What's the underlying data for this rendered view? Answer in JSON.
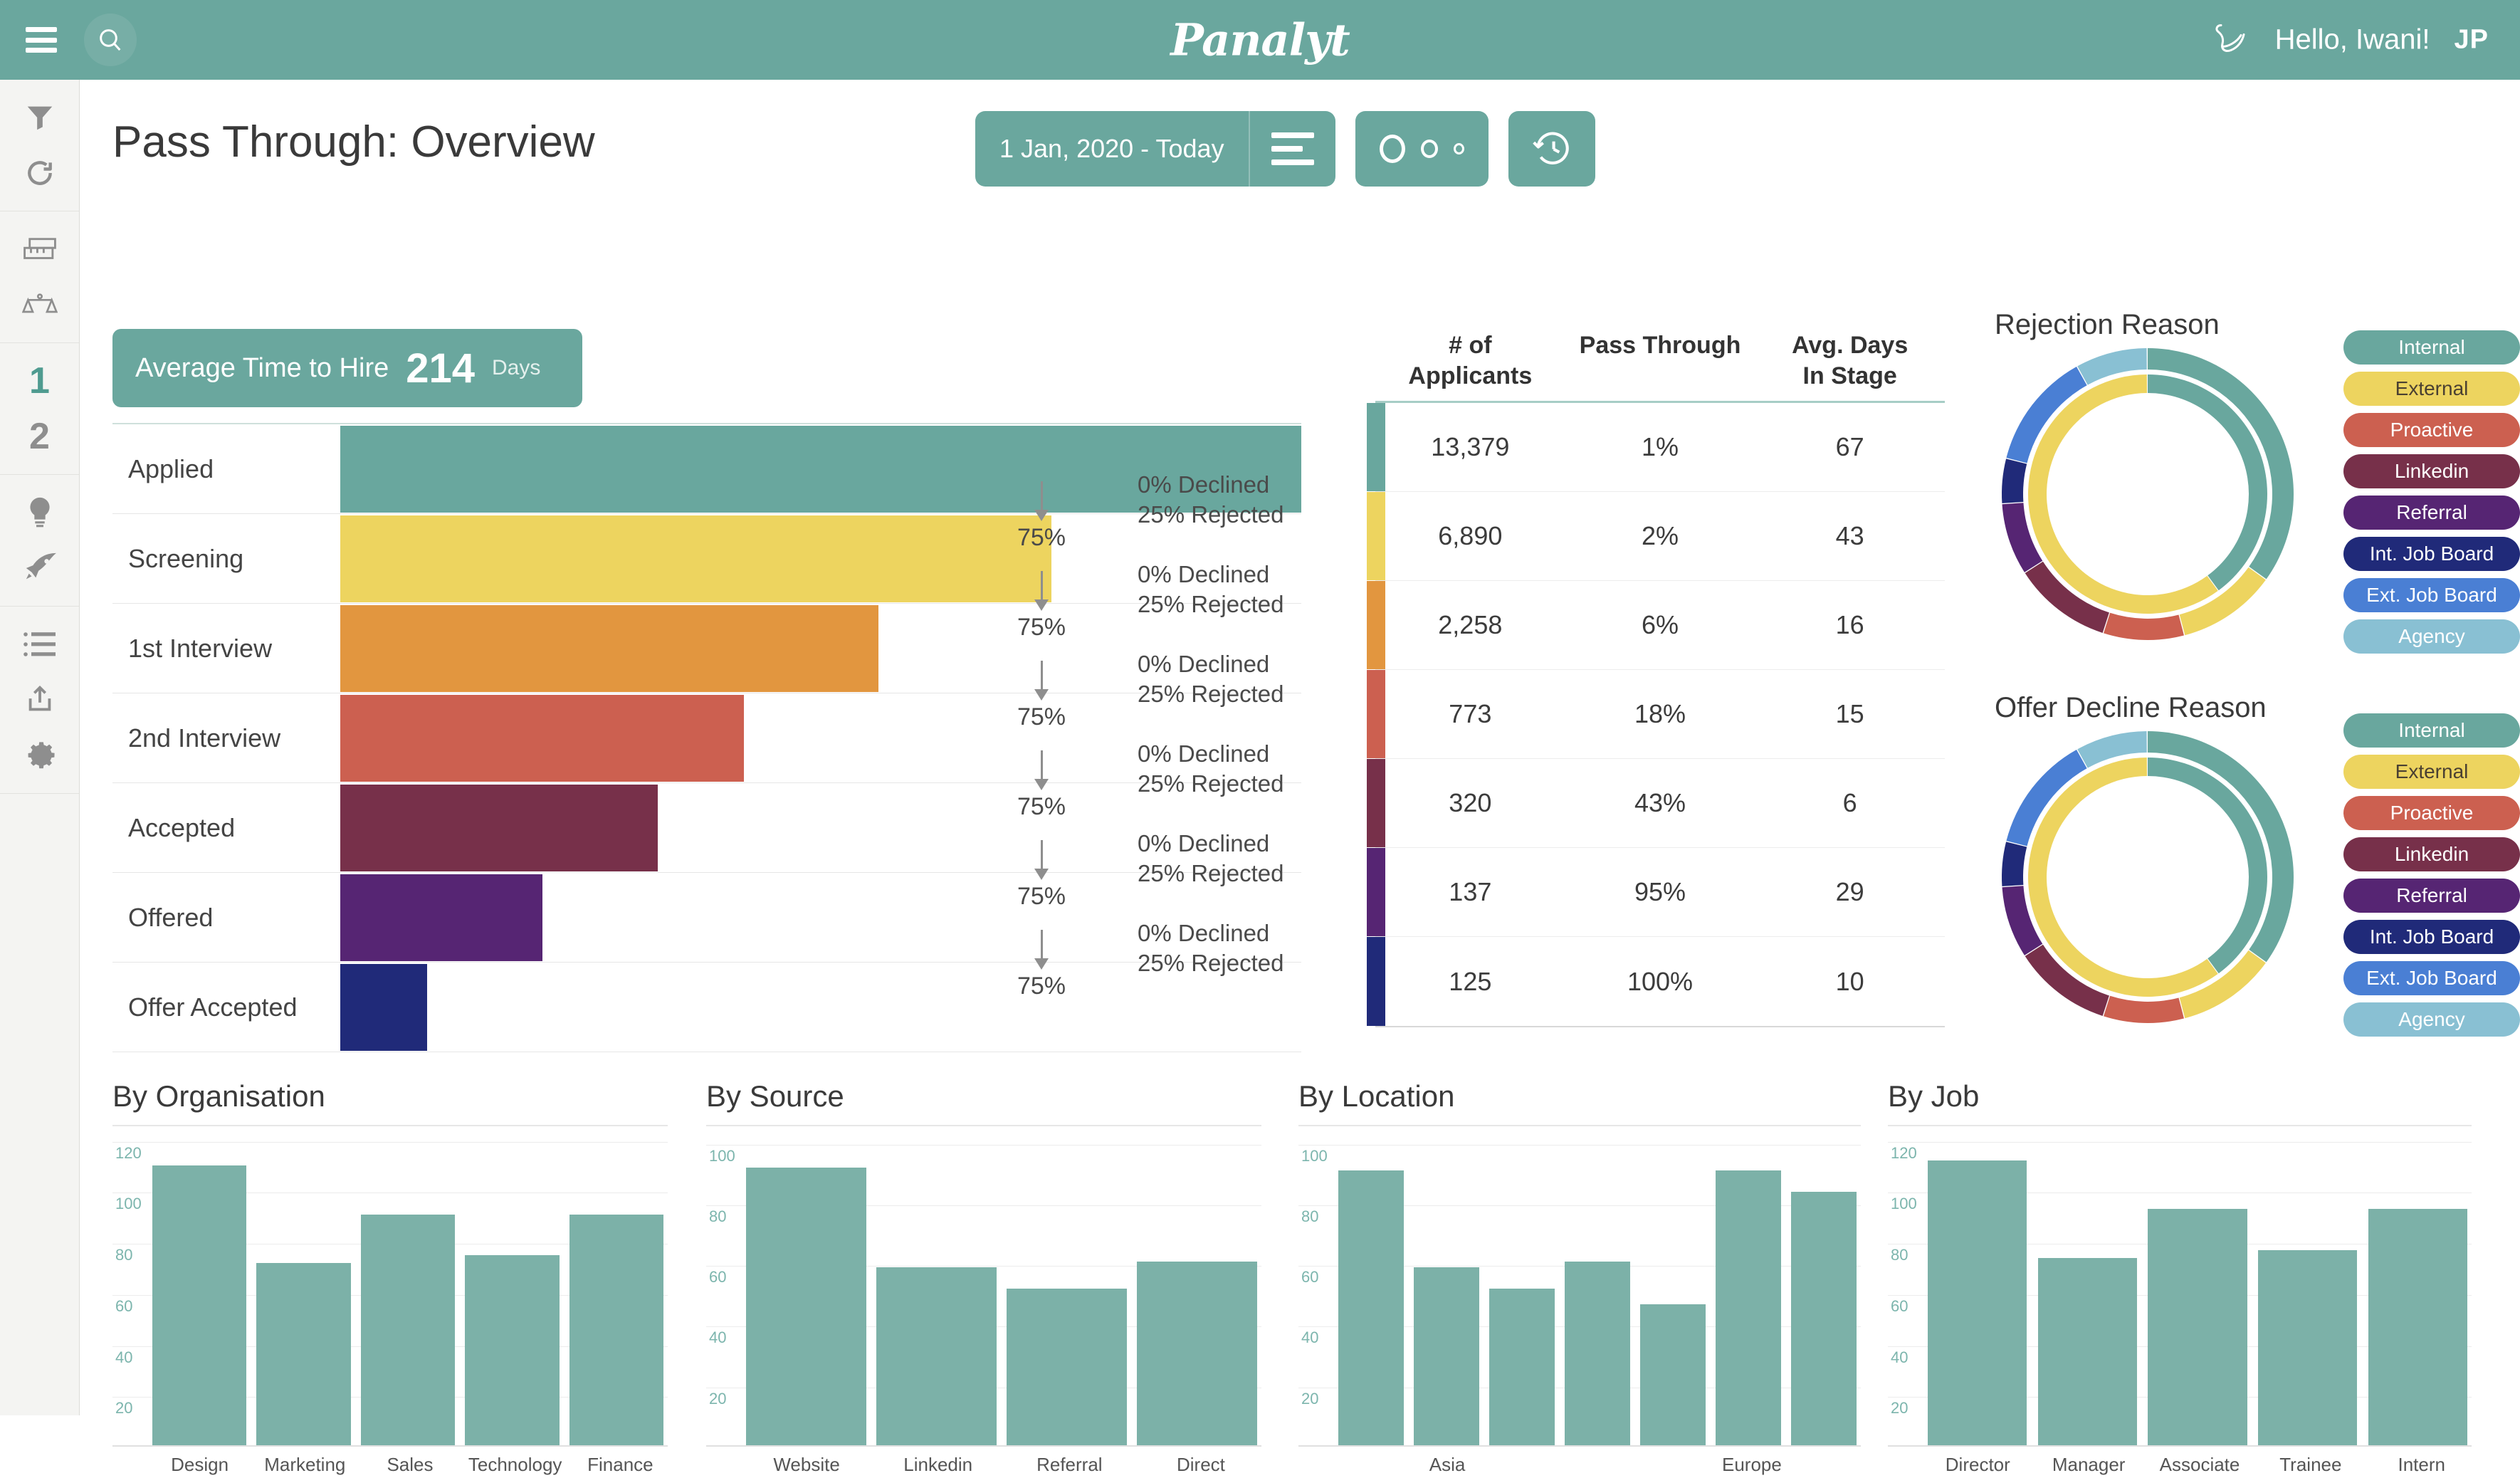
{
  "topbar": {
    "menu_icon": "hamburger-icon",
    "search_icon": "search-icon",
    "brand": "Panalyt",
    "swan_icon": "swan-logo-icon",
    "greeting": "Hello, Iwani!",
    "language": "JP"
  },
  "sidebar": {
    "items": [
      {
        "icon": "filter-icon",
        "name": "filter"
      },
      {
        "icon": "refresh-icon",
        "name": "refresh"
      },
      {
        "icon": "ruler-icon",
        "name": "measure"
      },
      {
        "icon": "scales-icon",
        "name": "compare"
      },
      {
        "icon": "number-one-icon",
        "name": "view-one",
        "label": "1",
        "active": true
      },
      {
        "icon": "number-two-icon",
        "name": "view-two",
        "label": "2",
        "active": false
      },
      {
        "icon": "lightbulb-icon",
        "name": "insights"
      },
      {
        "icon": "rocket-icon",
        "name": "actions"
      },
      {
        "icon": "list-icon",
        "name": "list"
      },
      {
        "icon": "share-icon",
        "name": "export"
      },
      {
        "icon": "gear-icon",
        "name": "settings"
      }
    ]
  },
  "header": {
    "title": "Pass Through: Overview",
    "date_range": "1 Jan, 2020 - Today",
    "date_filter_icon": "filter-lines-icon",
    "bubble_size_icon": "bubble-size-icon",
    "history_icon": "history-clock-icon"
  },
  "kpi": {
    "label": "Average Time to Hire",
    "value": "214",
    "unit": "Days"
  },
  "funnel": {
    "stages": [
      {
        "name": "Applied",
        "width_pct": 100,
        "color": "#69a79e"
      },
      {
        "name": "Screening",
        "width_pct": 74,
        "color": "#edd45f"
      },
      {
        "name": "1st Interview",
        "width_pct": 56,
        "color": "#e2963f"
      },
      {
        "name": "2nd Interview",
        "width_pct": 42,
        "color": "#cc6050"
      },
      {
        "name": "Accepted",
        "width_pct": 33,
        "color": "#77304a"
      },
      {
        "name": "Offered",
        "width_pct": 21,
        "color": "#562573"
      },
      {
        "name": "Offer Accepted",
        "width_pct": 9,
        "color": "#202a79"
      }
    ],
    "transitions": [
      {
        "pass_pct": "75%",
        "declined": "0% Declined",
        "rejected": "25% Rejected"
      },
      {
        "pass_pct": "75%",
        "declined": "0% Declined",
        "rejected": "25% Rejected"
      },
      {
        "pass_pct": "75%",
        "declined": "0% Declined",
        "rejected": "25% Rejected"
      },
      {
        "pass_pct": "75%",
        "declined": "0% Declined",
        "rejected": "25% Rejected"
      },
      {
        "pass_pct": "75%",
        "declined": "0% Declined",
        "rejected": "25% Rejected"
      },
      {
        "pass_pct": "75%",
        "declined": "0% Declined",
        "rejected": "25% Rejected"
      }
    ]
  },
  "table": {
    "headers": [
      "# of\nApplicants",
      "Pass Through",
      "Avg. Days\nIn Stage"
    ],
    "header_applicants_l1": "# of",
    "header_applicants_l2": "Applicants",
    "header_pass_through": "Pass Through",
    "header_days_l1": "Avg. Days",
    "header_days_l2": "In Stage",
    "rows": [
      {
        "color": "#69a79e",
        "applicants": "13,379",
        "pass_through": "1%",
        "avg_days": "67"
      },
      {
        "color": "#edd45f",
        "applicants": "6,890",
        "pass_through": "2%",
        "avg_days": "43"
      },
      {
        "color": "#e2963f",
        "applicants": "2,258",
        "pass_through": "6%",
        "avg_days": "16"
      },
      {
        "color": "#cc6050",
        "applicants": "773",
        "pass_through": "18%",
        "avg_days": "15"
      },
      {
        "color": "#77304a",
        "applicants": "320",
        "pass_through": "43%",
        "avg_days": "6"
      },
      {
        "color": "#562573",
        "applicants": "137",
        "pass_through": "95%",
        "avg_days": "29"
      },
      {
        "color": "#202a79",
        "applicants": "125",
        "pass_through": "100%",
        "avg_days": "10"
      }
    ]
  },
  "donuts": [
    {
      "title": "Rejection Reason",
      "legend": [
        {
          "label": "Internal",
          "color": "#69a79e",
          "text_dark": false
        },
        {
          "label": "External",
          "color": "#edd45f",
          "text_dark": true
        },
        {
          "label": "Proactive",
          "color": "#cc6050",
          "text_dark": false
        },
        {
          "label": "Linkedin",
          "color": "#77304a",
          "text_dark": false
        },
        {
          "label": "Referral",
          "color": "#562573",
          "text_dark": false
        },
        {
          "label": "Int. Job Board",
          "color": "#202a79",
          "text_dark": false
        },
        {
          "label": "Ext. Job Board",
          "color": "#4a7fd4",
          "text_dark": false
        },
        {
          "label": "Agency",
          "color": "#89c0d3",
          "text_dark": false
        }
      ]
    },
    {
      "title": "Offer Decline Reason",
      "legend": [
        {
          "label": "Internal",
          "color": "#69a79e",
          "text_dark": false
        },
        {
          "label": "External",
          "color": "#edd45f",
          "text_dark": true
        },
        {
          "label": "Proactive",
          "color": "#cc6050",
          "text_dark": false
        },
        {
          "label": "Linkedin",
          "color": "#77304a",
          "text_dark": false
        },
        {
          "label": "Referral",
          "color": "#562573",
          "text_dark": false
        },
        {
          "label": "Int. Job Board",
          "color": "#202a79",
          "text_dark": false
        },
        {
          "label": "Ext. Job Board",
          "color": "#4a7fd4",
          "text_dark": false
        },
        {
          "label": "Agency",
          "color": "#89c0d3",
          "text_dark": false
        }
      ]
    }
  ],
  "chart_data": [
    {
      "type": "pie",
      "title": "Rejection Reason",
      "legend_position": "right",
      "rings": [
        {
          "name": "outer",
          "categories": [
            "Internal",
            "External",
            "Proactive",
            "Linkedin",
            "Referral",
            "Int. Job Board",
            "Ext. Job Board",
            "Agency"
          ],
          "values": [
            35,
            11,
            9,
            11,
            8,
            5,
            13,
            8
          ],
          "colors": [
            "#69a79e",
            "#edd45f",
            "#cc6050",
            "#77304a",
            "#562573",
            "#202a79",
            "#4a7fd4",
            "#89c0d3"
          ]
        },
        {
          "name": "inner",
          "categories": [
            "Internal",
            "External"
          ],
          "values": [
            40,
            60
          ],
          "colors": [
            "#69a79e",
            "#edd45f"
          ]
        }
      ]
    },
    {
      "type": "pie",
      "title": "Offer Decline Reason",
      "legend_position": "right",
      "rings": [
        {
          "name": "outer",
          "categories": [
            "Internal",
            "External",
            "Proactive",
            "Linkedin",
            "Referral",
            "Int. Job Board",
            "Ext. Job Board",
            "Agency"
          ],
          "values": [
            35,
            11,
            9,
            11,
            8,
            5,
            13,
            8
          ],
          "colors": [
            "#69a79e",
            "#edd45f",
            "#cc6050",
            "#77304a",
            "#562573",
            "#202a79",
            "#4a7fd4",
            "#89c0d3"
          ]
        },
        {
          "name": "inner",
          "categories": [
            "Internal",
            "External"
          ],
          "values": [
            40,
            60
          ],
          "colors": [
            "#69a79e",
            "#edd45f"
          ]
        }
      ]
    },
    {
      "type": "bar",
      "title": "By Organisation",
      "categories": [
        "Design",
        "Marketing",
        "Sales",
        "Technology",
        "Finance"
      ],
      "values": [
        110,
        72,
        91,
        75,
        91
      ],
      "yticks": [
        20,
        40,
        60,
        80,
        100,
        120
      ],
      "ylim": [
        0,
        126
      ],
      "xlabel": "",
      "ylabel": "",
      "grid": true,
      "bar_color": "#7cb1a8"
    },
    {
      "type": "bar",
      "title": "By Source",
      "categories": [
        "Website",
        "Linkedin",
        "Referral",
        "Direct"
      ],
      "values": [
        92,
        59,
        52,
        61
      ],
      "yticks": [
        20,
        40,
        60,
        80,
        100
      ],
      "ylim": [
        0,
        106
      ],
      "xlabel": "",
      "ylabel": "",
      "grid": true,
      "bar_color": "#7cb1a8"
    },
    {
      "type": "bar",
      "title": "By Location",
      "categories": [
        "",
        "Asia",
        "",
        "",
        "",
        "Europe",
        ""
      ],
      "values": [
        91,
        59,
        52,
        61,
        47,
        91,
        84
      ],
      "yticks": [
        20,
        40,
        60,
        80,
        100
      ],
      "ylim": [
        0,
        106
      ],
      "xlabel": "",
      "ylabel": "",
      "grid": true,
      "bar_color": "#7cb1a8"
    },
    {
      "type": "bar",
      "title": "By Job",
      "categories": [
        "Director",
        "Manager",
        "Associate",
        "Trainee",
        "Intern"
      ],
      "values": [
        112,
        74,
        93,
        77,
        93
      ],
      "yticks": [
        20,
        40,
        60,
        80,
        100,
        120
      ],
      "ylim": [
        0,
        126
      ],
      "xlabel": "",
      "ylabel": "",
      "grid": true,
      "bar_color": "#7cb1a8"
    }
  ],
  "bottom_charts": [
    {
      "title": "By Organisation"
    },
    {
      "title": "By Source"
    },
    {
      "title": "By Location"
    },
    {
      "title": "By Job"
    }
  ],
  "theme": {
    "brand_teal": "#6aa79e",
    "bar_teal": "#7cb1a8",
    "tick_teal": "#7cb5ad"
  }
}
